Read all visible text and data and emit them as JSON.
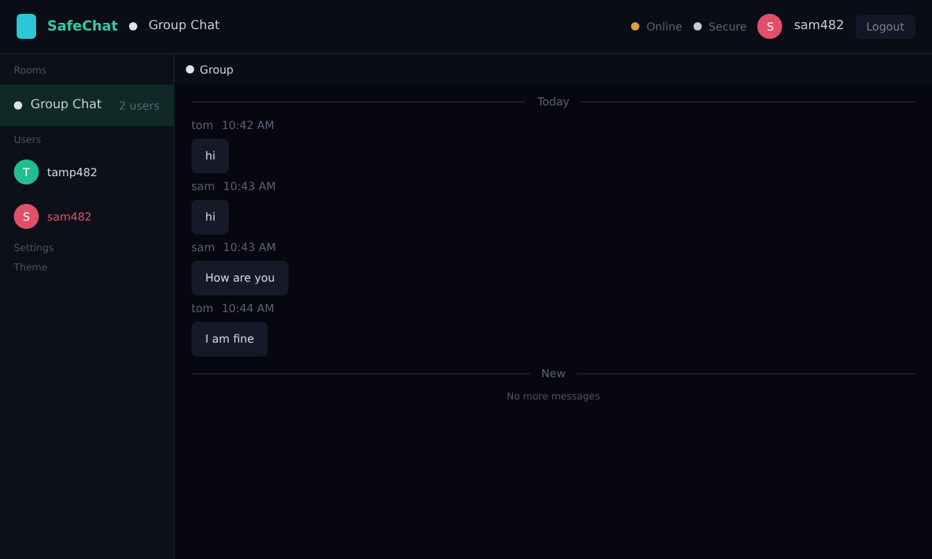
{
  "header": {
    "brand": "SafeChat",
    "room": "Group Chat",
    "status_items": [
      {
        "label": "Online",
        "color": "#e0a040"
      },
      {
        "label": "Secure",
        "color": "#c8ccd8"
      }
    ],
    "user": {
      "initials": "S",
      "name": "sam482"
    },
    "logout": "Logout"
  },
  "sidebar": {
    "rooms_heading": "Rooms",
    "rooms": [
      {
        "name": "Group Chat",
        "meta": "2 users",
        "selected": true
      }
    ],
    "users_heading": "Users",
    "users": [
      {
        "initials": "T",
        "name": "tamp482",
        "color": "#1fbf8f"
      },
      {
        "initials": "S",
        "name": "sam482",
        "color": "#e0506a"
      }
    ],
    "footer_heading": "Settings",
    "footer_label": "Theme"
  },
  "chat": {
    "tab": "Group",
    "date_divider": "Today",
    "messages": [
      {
        "author": "tom",
        "time": "10:42 AM",
        "text": "hi"
      },
      {
        "author": "sam",
        "time": "10:43 AM",
        "text": "hi"
      },
      {
        "author": "sam",
        "time": "10:43 AM",
        "text": "How are you"
      },
      {
        "author": "tom",
        "time": "10:44 AM",
        "text": "I am fine"
      }
    ],
    "new_divider": "New",
    "footer_note": "No more messages"
  }
}
